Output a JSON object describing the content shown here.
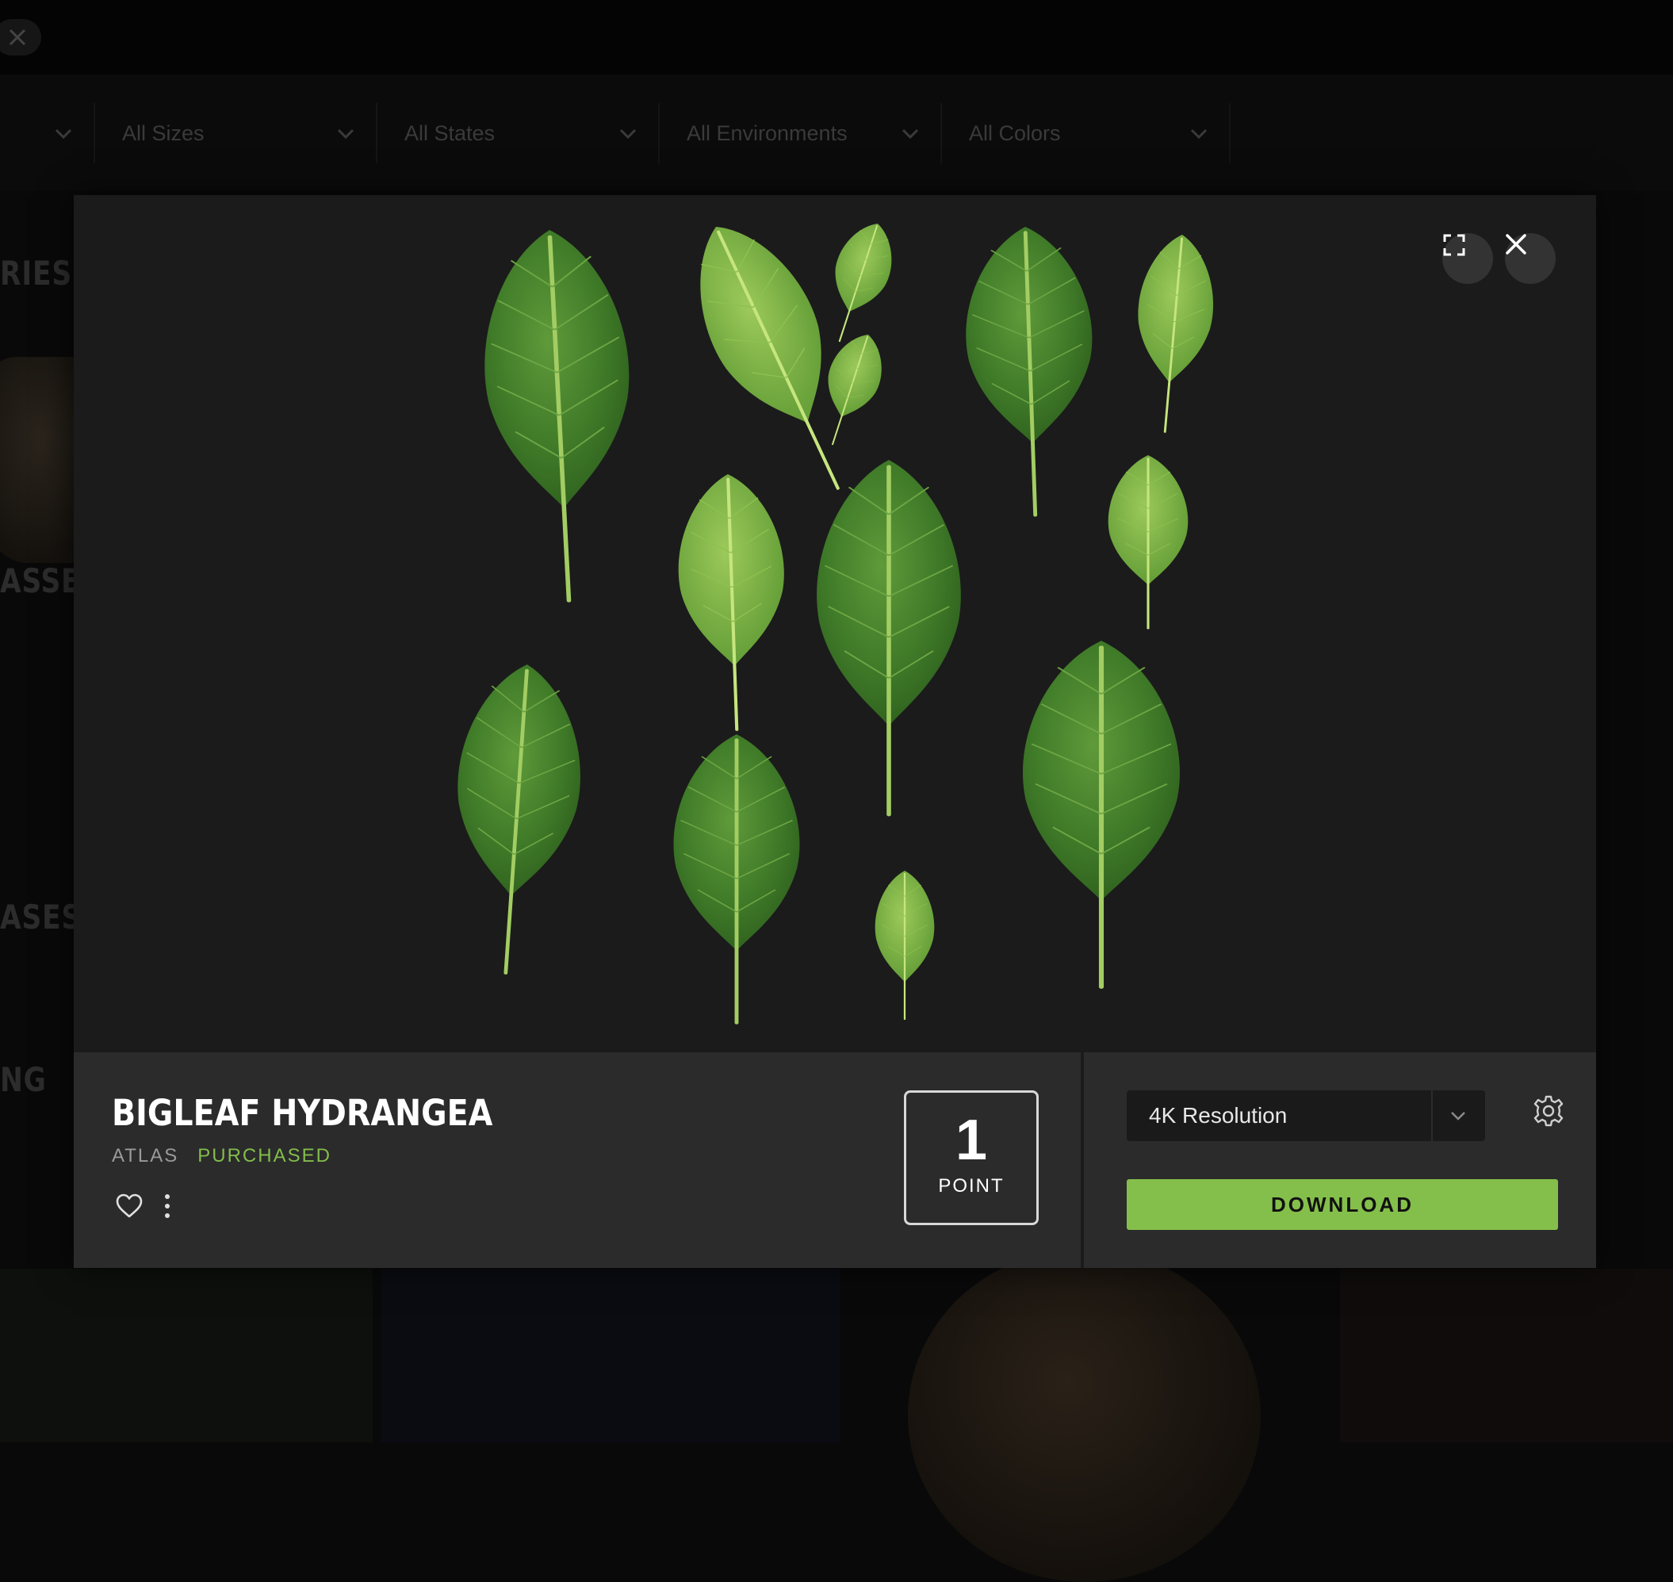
{
  "background": {
    "filters": [
      {
        "label": ""
      },
      {
        "label": "All Sizes"
      },
      {
        "label": "All States"
      },
      {
        "label": "All Environments"
      },
      {
        "label": "All Colors"
      }
    ],
    "headings": [
      "RIES",
      "ASSET",
      "ASES",
      "NG"
    ]
  },
  "asset": {
    "title": "BIGLEAF HYDRANGEA",
    "type": "ATLAS",
    "status": "PURCHASED",
    "points_value": "1",
    "points_unit": "POINT",
    "resolution": "4K Resolution",
    "download_label": "DOWNLOAD"
  },
  "colors": {
    "accent": "#84bf4b",
    "modal_bg": "#1b1b1b",
    "info_bg": "#2b2b2b"
  },
  "icons": [
    "close-icon",
    "fullscreen-icon",
    "heart-icon",
    "more-vertical-icon",
    "chevron-down-icon",
    "settings-icon"
  ]
}
